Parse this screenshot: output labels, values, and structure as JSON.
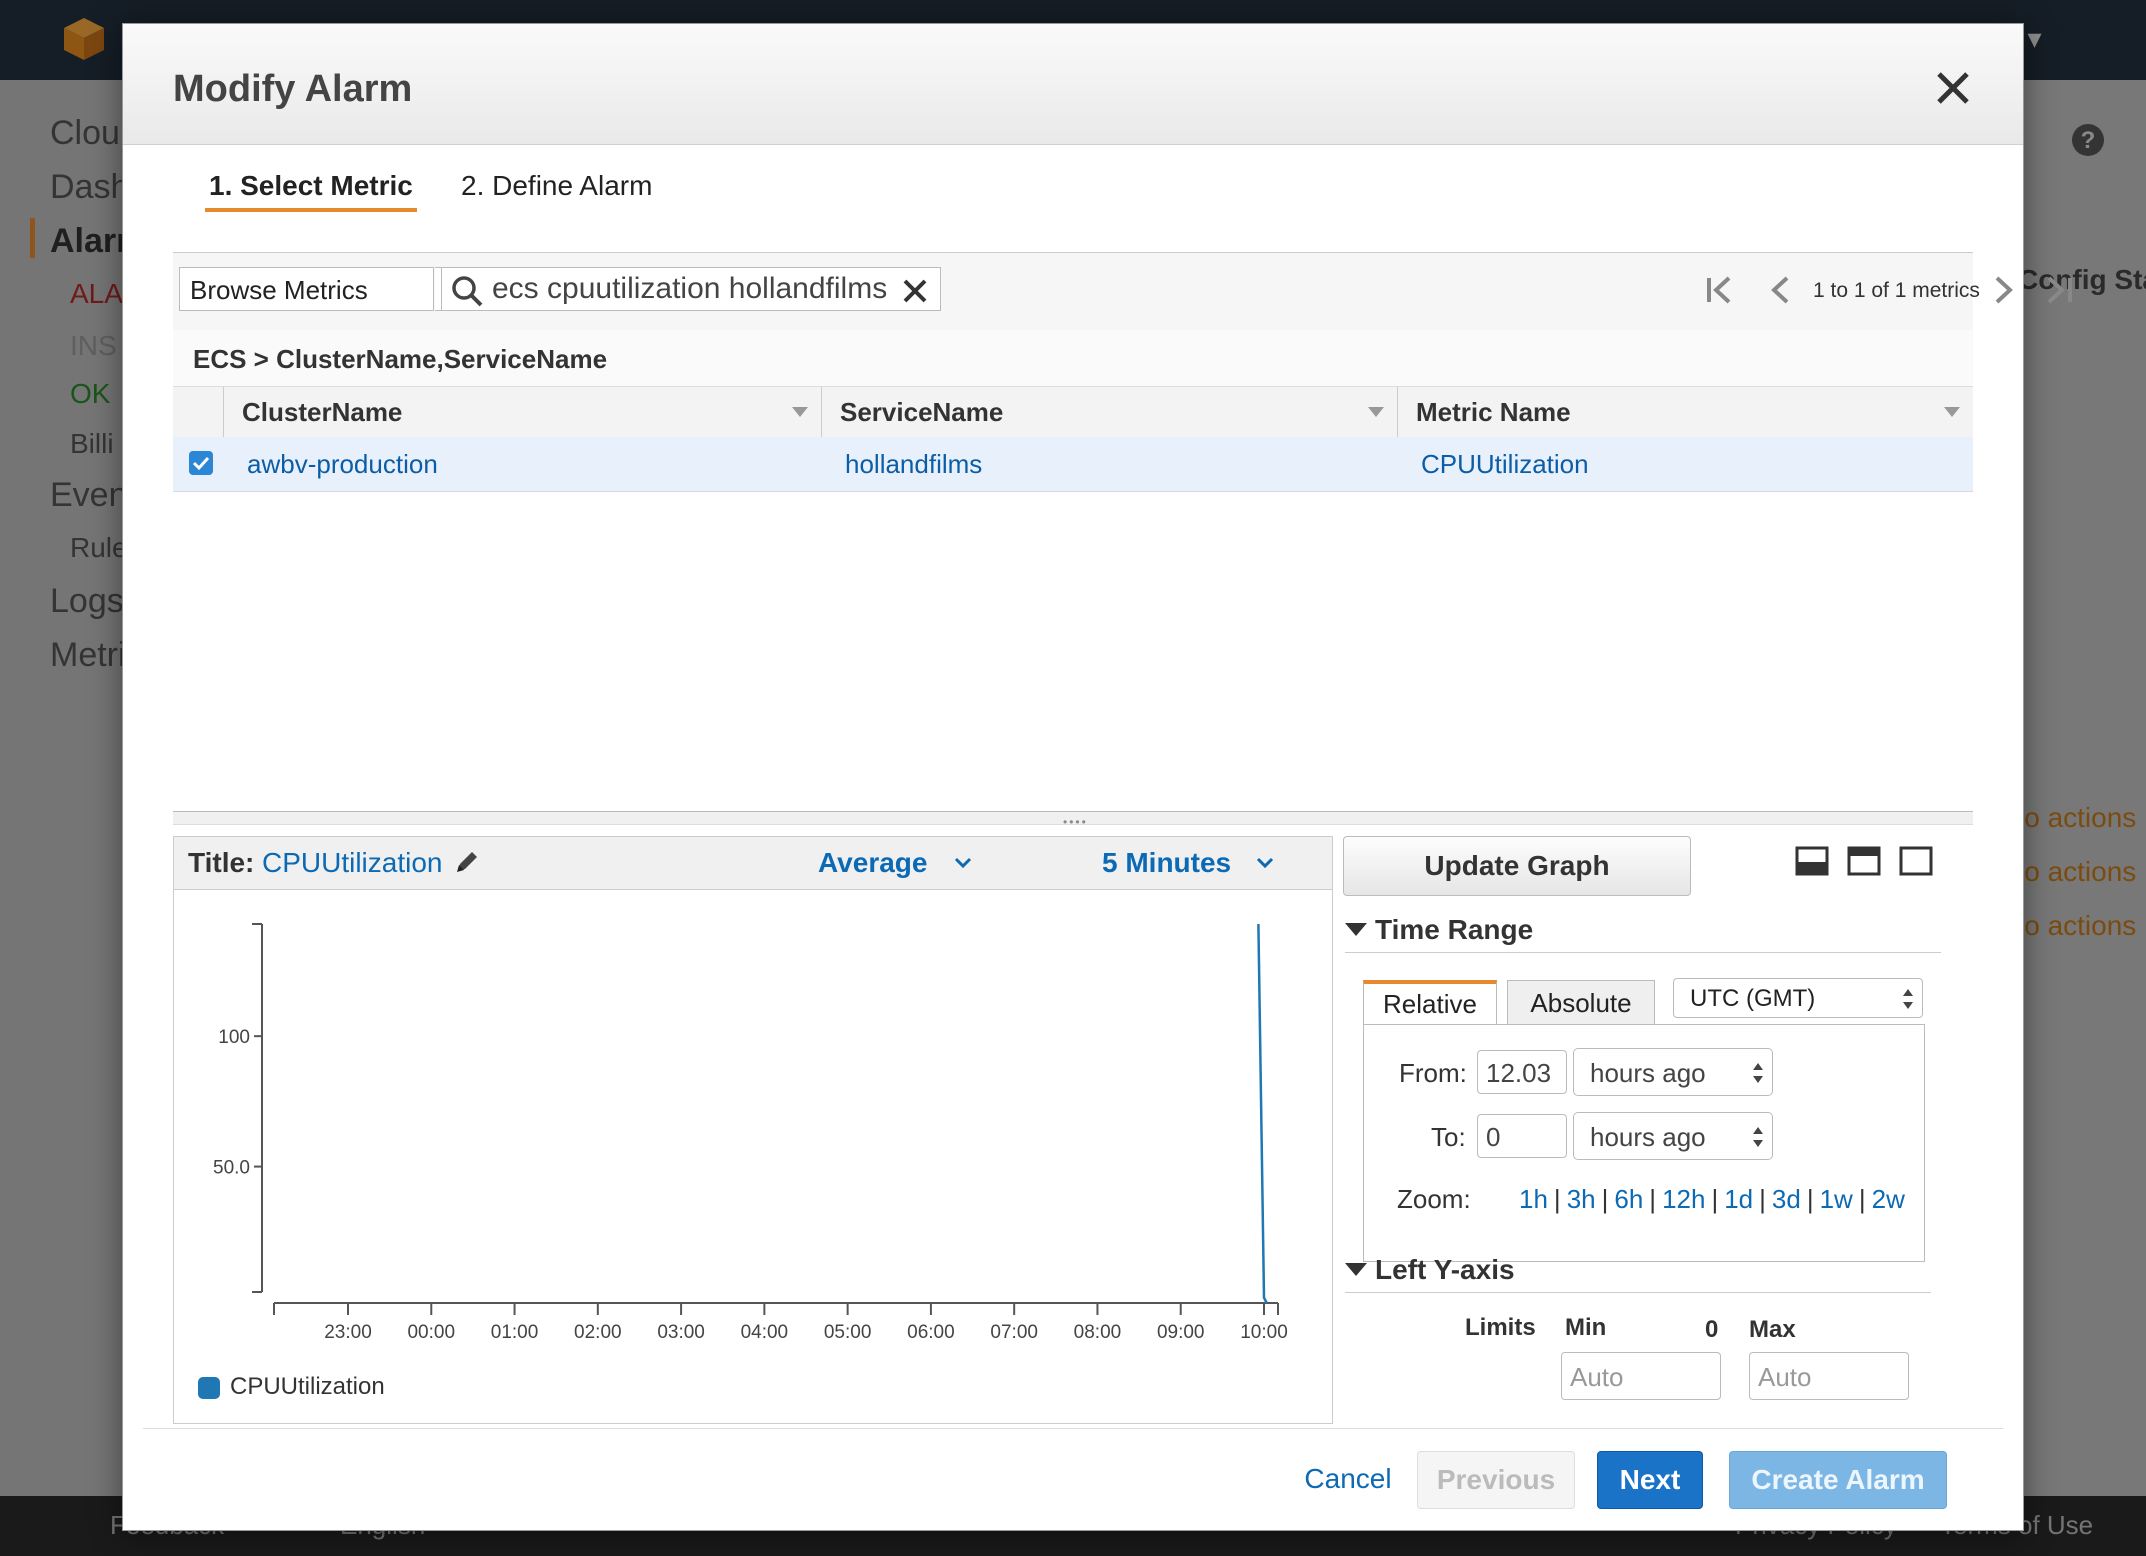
{
  "background": {
    "user_menu": "t ▾",
    "nav": [
      "Clou",
      "Dash",
      "Alarr",
      "ALA",
      "INS",
      "OK",
      "Billi",
      "Even",
      "Rule",
      "Logs",
      "Metri"
    ],
    "right_text": [
      "Config Sta",
      "lo actions",
      "lo actions",
      "lo actions"
    ],
    "bottom": {
      "feedback": "Feedback",
      "language": "English",
      "privacy": "Privacy Policy",
      "terms": "Terms of Use"
    }
  },
  "modal": {
    "title": "Modify Alarm",
    "steps": [
      "1. Select Metric",
      "2. Define Alarm"
    ],
    "browse_label": "Browse Metrics",
    "search_value": "ecs cpuutilization hollandfilms",
    "pager_text": "1 to 1 of 1 metrics",
    "group_label": "ECS > ClusterName,ServiceName",
    "columns": [
      "ClusterName",
      "ServiceName",
      "Metric Name"
    ],
    "row": {
      "checked": true,
      "cluster": "awbv-production",
      "service": "hollandfilms",
      "metric": "CPUUtilization"
    },
    "graph": {
      "title_label": "Title:",
      "title_value": "CPUUtilization",
      "statistic": "Average",
      "period": "5 Minutes",
      "legend": "CPUUtilization"
    },
    "update_graph": "Update Graph",
    "time_range": {
      "heading": "Time Range",
      "tabs": [
        "Relative",
        "Absolute"
      ],
      "timezone": "UTC (GMT)",
      "from_label": "From:",
      "from_value": "12.03",
      "from_unit": "hours ago",
      "to_label": "To:",
      "to_value": "0",
      "to_unit": "hours ago",
      "zoom_label": "Zoom:",
      "zoom_options": [
        "1h",
        "3h",
        "6h",
        "12h",
        "1d",
        "3d",
        "1w",
        "2w"
      ]
    },
    "left_y_axis": {
      "heading": "Left Y-axis",
      "limits_label": "Limits",
      "min_label": "Min",
      "min_value_marker": "0",
      "max_label": "Max",
      "min_placeholder": "Auto",
      "max_placeholder": "Auto"
    },
    "buttons": {
      "cancel": "Cancel",
      "previous": "Previous",
      "next": "Next",
      "create": "Create Alarm"
    }
  },
  "chart_data": {
    "type": "line",
    "x_ticks": [
      "23:00",
      "00:00",
      "01:00",
      "02:00",
      "03:00",
      "04:00",
      "05:00",
      "06:00",
      "07:00",
      "08:00",
      "09:00",
      "10:00"
    ],
    "y_ticks": [
      "100",
      "50.0"
    ],
    "ylim": [
      0,
      143
    ],
    "series": [
      {
        "name": "CPUUtilization",
        "color": "#1f77b4",
        "points": [
          [
            "09:56",
            143
          ],
          [
            "10:00",
            2
          ],
          [
            "10:02",
            0
          ]
        ]
      }
    ]
  }
}
